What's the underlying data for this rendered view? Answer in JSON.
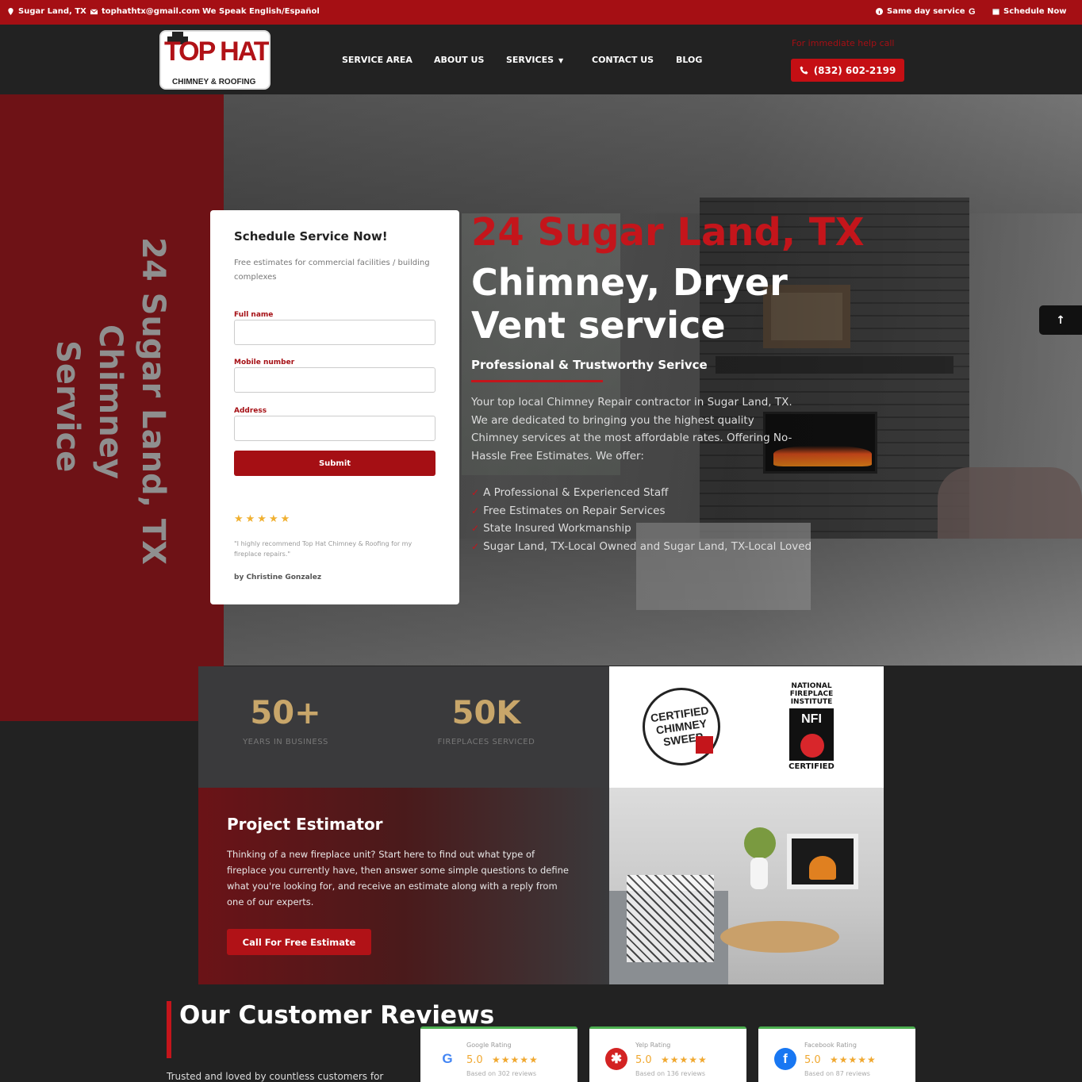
{
  "topbar": {
    "location": "Sugar Land, TX",
    "email": "tophathtx@gmail.com",
    "languages": "We Speak English/Español",
    "same_day": "Same day service",
    "schedule": "Schedule Now"
  },
  "header": {
    "logo_brand": "TOP HAT",
    "logo_sub": "CHIMNEY & ROOFING",
    "nav": [
      "SERVICE AREA",
      "ABOUT US",
      "SERVICES",
      "CONTACT US",
      "BLOG"
    ],
    "emergency": "For immediate help call",
    "phone": "(832) 602-2199"
  },
  "hero": {
    "vertical_lines": [
      "24 Sugar Land, TX",
      "Chimney",
      "Service"
    ],
    "city": "24 Sugar Land, TX",
    "headline": "Chimney, Dryer Vent service",
    "subheadline": "Professional & Trustworthy Serivce",
    "description": "Your top local Chimney Repair contractor in Sugar Land, TX. We are dedicated to bringing you the highest quality Chimney services at the most affordable rates. Offering No-Hassle Free Estimates. We offer:",
    "list": [
      "A Professional & Experienced Staff",
      "Free Estimates on Repair Services",
      "State Insured Workmanship",
      "Sugar Land, TX-Local Owned and Sugar Land, TX-Local Loved"
    ]
  },
  "form": {
    "title": "Schedule Service Now!",
    "description": "Free estimates for commercial facilities / building complexes",
    "fields": {
      "full_name": "Full name",
      "mobile": "Mobile number",
      "address": "Address"
    },
    "submit": "Submit",
    "stars": "★★★★★",
    "quote": "\"I highly recommend Top Hat Chimney & Roofing for my fireplace repairs.\"",
    "author": "by Christine Gonzalez"
  },
  "stats": [
    {
      "value": "50+",
      "label": "YEARS IN BUSINESS"
    },
    {
      "value": "50K",
      "label": "FIREPLACES SERVICED"
    }
  ],
  "certs": {
    "csia": "CERTIFIED CHIMNEY SWEEP",
    "nfi_top": "NATIONAL FIREPLACE INSTITUTE",
    "nfi_mark": "NFI",
    "nfi_bottom": "CERTIFIED"
  },
  "estimator": {
    "title": "Project Estimator",
    "text": "Thinking of a new fireplace unit? Start here to find out what type of fireplace you currently have, then answer some simple questions to define what you're looking for, and receive an estimate along with a reply from one of our experts.",
    "button": "Call For Free Estimate"
  },
  "reviews": {
    "title": "Our Customer Reviews",
    "subtitle": "Trusted and loved by countless customers for",
    "cards": [
      {
        "label": "Google Rating",
        "score": "5.0",
        "stars": "★★★★★",
        "count": "Based on 302 reviews",
        "logo": "G",
        "color": "#4285f4"
      },
      {
        "label": "Yelp Rating",
        "score": "5.0",
        "stars": "★★★★★",
        "count": "Based on 136 reviews",
        "logo": "✱",
        "color": "#d32323"
      },
      {
        "label": "Facebook Rating",
        "score": "5.0",
        "stars": "★★★★★",
        "count": "Based on 87 reviews",
        "logo": "f",
        "color": "#1877f2"
      }
    ]
  },
  "colors": {
    "brand_red": "#a50f14",
    "accent_gold": "#c8a66a",
    "dark_bg": "#222222"
  }
}
